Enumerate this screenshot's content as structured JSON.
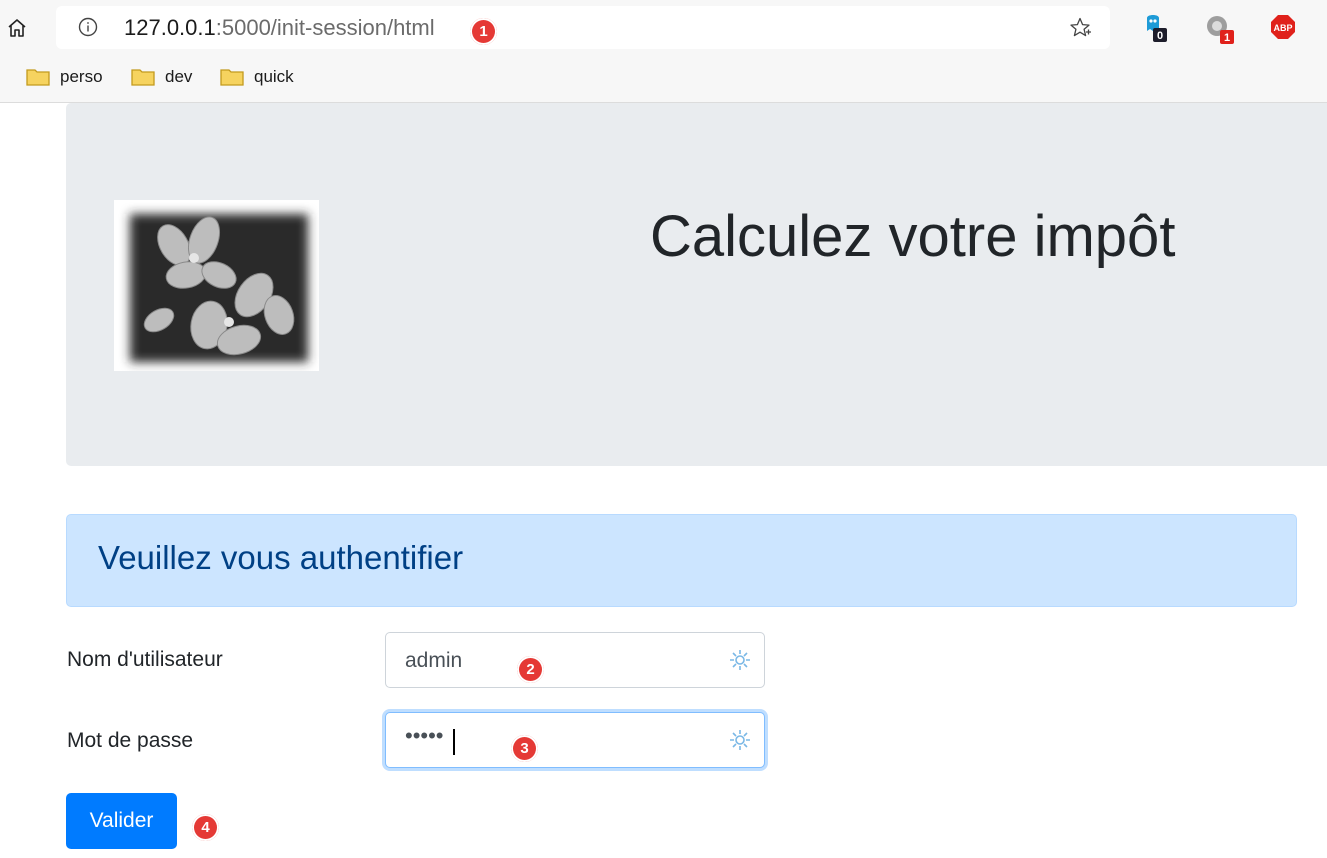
{
  "browser": {
    "url_host": "127.0.0.1",
    "url_path": ":5000/init-session/html",
    "bookmarks": [
      "perso",
      "dev",
      "quick"
    ],
    "extensions": [
      {
        "name": "ghostery-icon",
        "badge": "0"
      },
      {
        "name": "privacy-extension-icon",
        "badge": "1"
      },
      {
        "name": "adblock-plus-icon",
        "label": "ABP"
      }
    ]
  },
  "annotations": [
    "1",
    "2",
    "3",
    "4"
  ],
  "header": {
    "title": "Calculez votre impôt"
  },
  "alert": {
    "text": "Veuillez vous authentifier"
  },
  "form": {
    "user_label": "Nom d'utilisateur",
    "user_value": "admin",
    "password_label": "Mot de passe",
    "password_value": "•••••",
    "submit_label": "Valider"
  },
  "colors": {
    "primary": "#007bff",
    "alert_bg": "#cce5ff",
    "alert_text": "#004085",
    "jumbotron_bg": "#e9ecef",
    "annotation_red": "#e53935"
  }
}
